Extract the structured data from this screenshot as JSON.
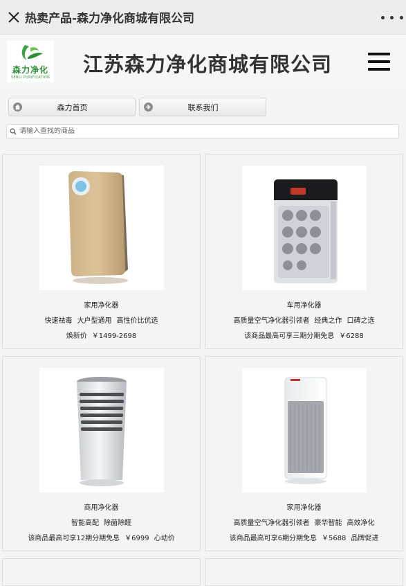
{
  "titlebar": {
    "title": "热卖产品-森力净化商城有限公司",
    "close_icon": "close-icon",
    "more_icon": "more-icon"
  },
  "header": {
    "logo_text": "森力净化",
    "logo_subtext": "SENLI PURIFICATION",
    "company_name": "江苏森力净化商城有限公司",
    "menu_icon": "hamburger-menu-icon"
  },
  "nav": {
    "home_label": "森力首页",
    "home_icon": "home-icon",
    "contact_label": "联系我们",
    "contact_icon": "arrow-right-circle-icon"
  },
  "search": {
    "placeholder": "请输入查找的商品",
    "icon": "search-icon"
  },
  "products": [
    {
      "name": "家用净化器",
      "tags": [
        "快速祛毒",
        "大户型通用",
        "高性价比优选"
      ],
      "price_label": "焕新价",
      "price": "￥1499-2698",
      "price_suffix": ""
    },
    {
      "name": "车用净化器",
      "tags": [
        "高质量空气净化器引领者",
        "经典之作",
        "口碑之选"
      ],
      "price_label": "该商品最高可享三期分期免息",
      "price": "￥6288",
      "price_suffix": ""
    },
    {
      "name": "商用净化器",
      "tags": [
        "智能高配",
        "除菌除醛"
      ],
      "price_label": "该商品最高可享12期分期免息",
      "price": "￥6999",
      "price_suffix": "心动价"
    },
    {
      "name": "家用净化器",
      "tags": [
        "高质量空气净化器引领者",
        "豪华智能",
        "高效净化"
      ],
      "price_label": "该商品最高可享6期分期免息",
      "price": "￥5688",
      "price_suffix": "品牌促进"
    }
  ],
  "colors": {
    "logo_green": "#2f8f38",
    "titlebar_bg": "#ececec",
    "page_bg": "#f4f4f4"
  }
}
